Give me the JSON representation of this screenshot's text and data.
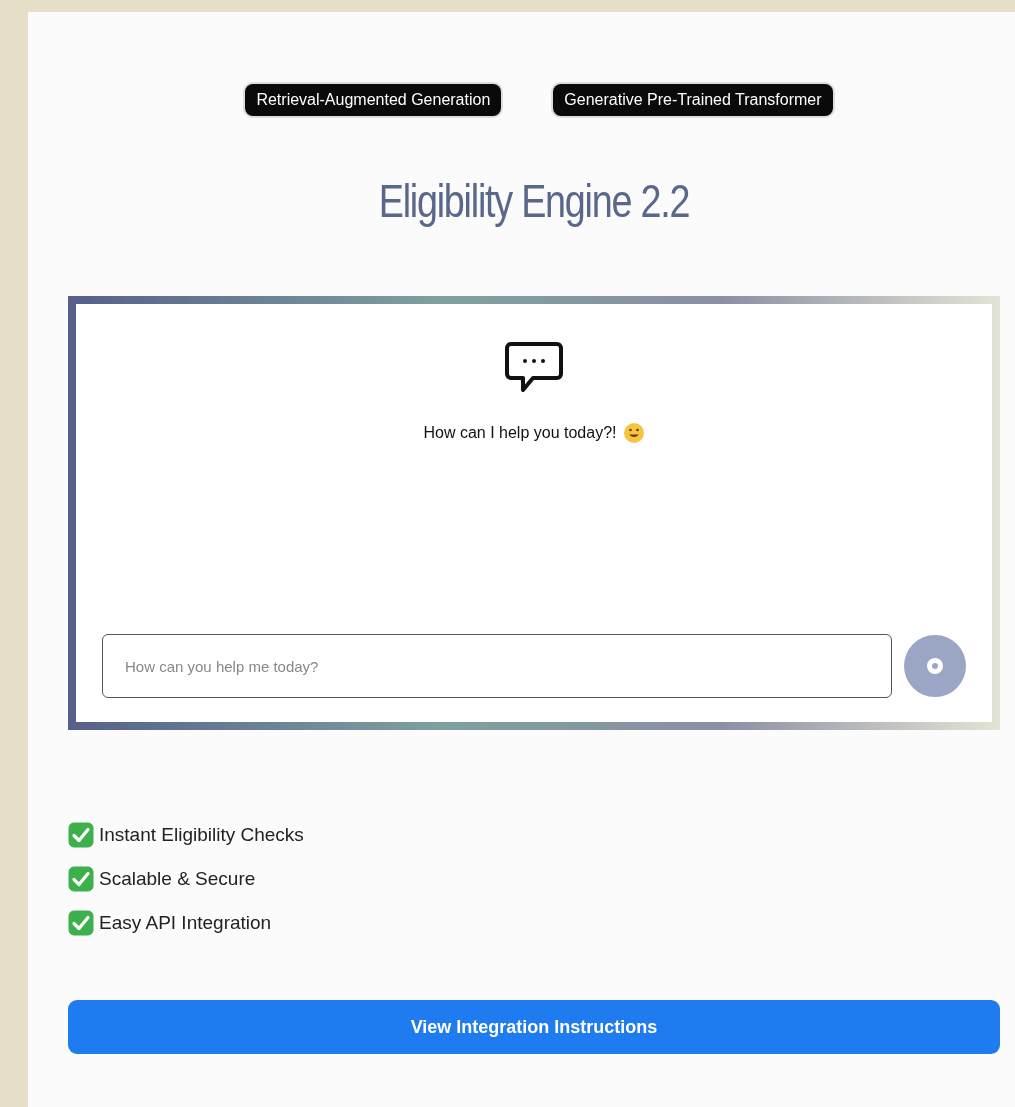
{
  "badges": [
    "Retrieval-Augmented Generation",
    "Generative Pre-Trained Transformer"
  ],
  "title": "Eligibility Engine 2.2",
  "chat": {
    "greeting": "How can I help you today?!",
    "input": {
      "placeholder": "How can you help me today?"
    }
  },
  "features": [
    {
      "label": "Instant Eligibility Checks",
      "checked": true
    },
    {
      "label": "Scalable & Secure",
      "checked": true
    },
    {
      "label": "Easy API Integration",
      "checked": true
    }
  ],
  "action_button": "View Integration Instructions"
}
